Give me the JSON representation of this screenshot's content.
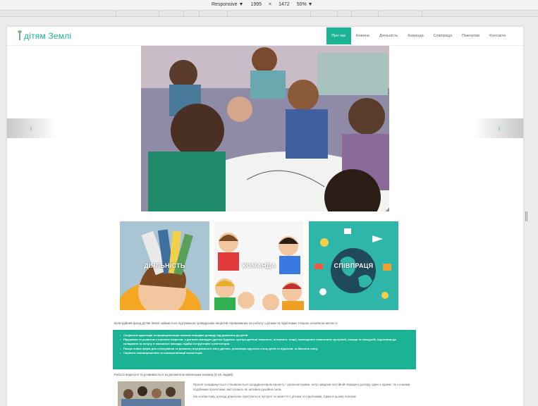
{
  "devtools": {
    "device": "Responsive ▼",
    "width": "1995",
    "times": "×",
    "height": "1472",
    "zoom": "50% ▼"
  },
  "site": {
    "logo_text": "дітям Землі",
    "nav": [
      {
        "label": "Про нас",
        "active": true
      },
      {
        "label": "Новини"
      },
      {
        "label": "Діяльність"
      },
      {
        "label": "Команда"
      },
      {
        "label": "Співпраця"
      },
      {
        "label": "Пожертви"
      },
      {
        "label": "Контакти"
      }
    ]
  },
  "slider": {
    "prev_icon": "chevron-left",
    "next_icon": "chevron-right",
    "arrow_color": "#8fd6c2"
  },
  "tiles": [
    {
      "label": "ДІЯЛЬНІСТЬ",
      "bg": "#9fb8c8"
    },
    {
      "label": "КОМАНДА",
      "bg": "#f4f4f4"
    },
    {
      "label": "СПІВПРАЦЯ",
      "bg": "#2bb5a8"
    }
  ],
  "intro_text": "Благодійний фонд Дітям Землі займається підтримкою громадських ініціатив спрямованих на роботу з дітьми та підлітками. Нашою основною метою є:",
  "goals": [
    "Соціальна адаптація та профорієнтація шляхом передачі досвіду від дорослих до дітей",
    "Підтримка та розвиток сторонніх ініціатив: з дитячих закладах (дитячі будинки, центри дитячої творчості, інтернати, тощо), проведення тематичних зустрічей, походи та екскурсій, підготовка до складання та вступу в навчальні заклади, підбір інструкторів і репетиторів.",
    "Пошук нових форм для спілкування та розвитку внутрішнього світу дитини, реалізація круглого столу дітей та підлітків, та бачення світу.",
    "Сприяти самовираженню та самоорганізації волонтерів."
  ],
  "after_text": "Робота ведеться та розвивається за допомогою маленьких команд (5-15 людей).",
  "bottom_paragraphs": [
    "Проект координується і поширюється координатором проекту і організаторами, котрі завдяки постійній передачі досвіду один з одним, та з іншими подібними проектами, виступають як активна рушійна сила.",
    "На особистому досвіді дорослих ґрунтуються зустрічі та заняття з дітьми та підлітками. Саме в цьому полягає"
  ],
  "colors": {
    "accent": "#1ab394"
  }
}
